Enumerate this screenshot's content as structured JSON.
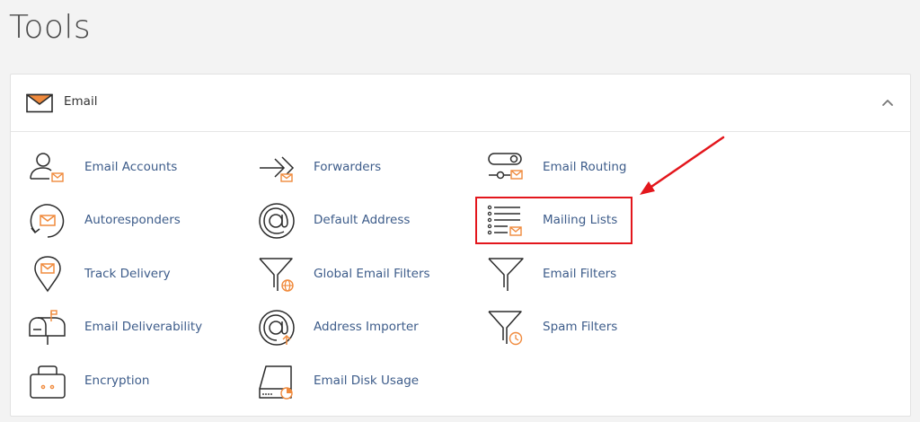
{
  "page": {
    "title": "Tools"
  },
  "section": {
    "label": "Email"
  },
  "tools": [
    {
      "id": "email-accounts",
      "label": "Email Accounts",
      "icon": "user-mail-icon"
    },
    {
      "id": "forwarders",
      "label": "Forwarders",
      "icon": "forward-arrow-icon"
    },
    {
      "id": "email-routing",
      "label": "Email Routing",
      "icon": "routing-icon"
    },
    {
      "id": "autoresponders",
      "label": "Autoresponders",
      "icon": "autoresponder-icon"
    },
    {
      "id": "default-address",
      "label": "Default Address",
      "icon": "at-sign-icon"
    },
    {
      "id": "mailing-lists",
      "label": "Mailing Lists",
      "icon": "list-mail-icon"
    },
    {
      "id": "track-delivery",
      "label": "Track Delivery",
      "icon": "location-pin-icon"
    },
    {
      "id": "global-email-filters",
      "label": "Global Email Filters",
      "icon": "funnel-globe-icon"
    },
    {
      "id": "email-filters",
      "label": "Email Filters",
      "icon": "funnel-icon"
    },
    {
      "id": "email-deliverability",
      "label": "Email Deliverability",
      "icon": "mailbox-icon"
    },
    {
      "id": "address-importer",
      "label": "Address Importer",
      "icon": "at-import-icon"
    },
    {
      "id": "spam-filters",
      "label": "Spam Filters",
      "icon": "funnel-clock-icon"
    },
    {
      "id": "encryption",
      "label": "Encryption",
      "icon": "lock-box-icon"
    },
    {
      "id": "email-disk-usage",
      "label": "Email Disk Usage",
      "icon": "disk-usage-icon"
    }
  ],
  "colors": {
    "accent": "#f08a3c",
    "link": "#3d5c8a",
    "highlight": "#e3161c",
    "icon_stroke": "#2b2b2b"
  }
}
